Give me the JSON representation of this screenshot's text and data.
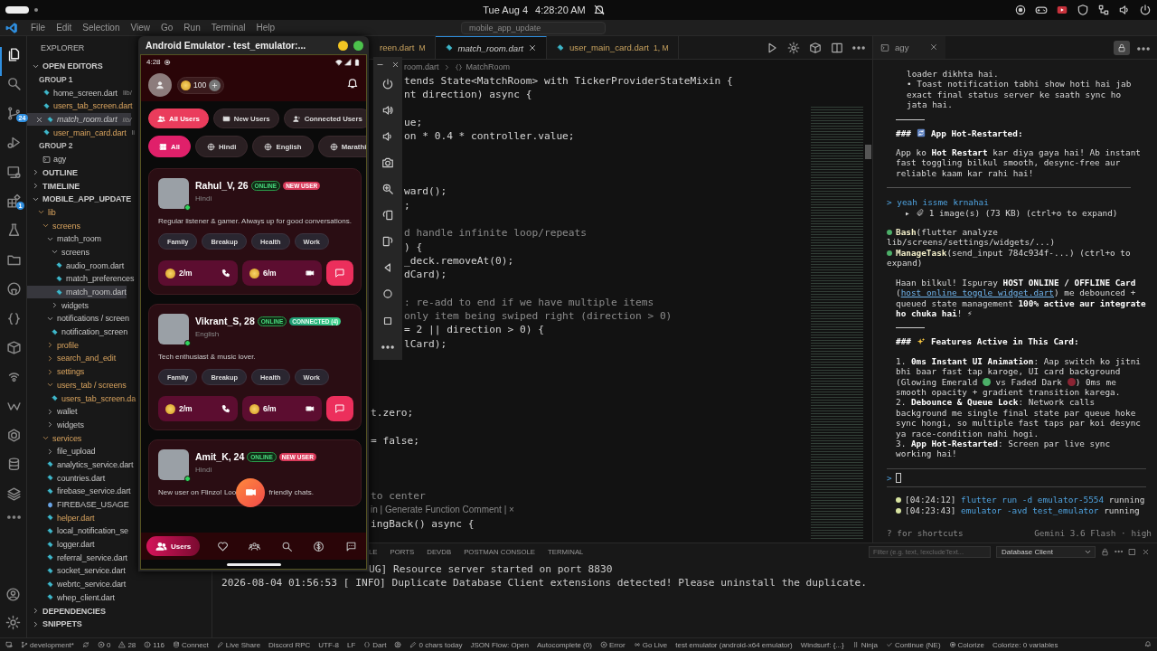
{
  "os_bar": {
    "date": "Tue Aug 4",
    "time": "4:28:20 AM"
  },
  "title_bar": {
    "menu": [
      "File",
      "Edit",
      "Selection",
      "View",
      "Go",
      "Run",
      "Terminal",
      "Help"
    ],
    "command_center": "mobile_app_update"
  },
  "activity_bar": [
    {
      "selected": true
    },
    {
      "selected": false
    },
    {
      "selected": false,
      "badge": "24"
    },
    {
      "selected": false
    },
    {
      "selected": false
    },
    {
      "selected": false,
      "badge": "1"
    },
    {
      "selected": false
    },
    {
      "selected": false
    },
    {
      "selected": false
    },
    {
      "selected": false
    },
    {
      "selected": false
    },
    {
      "selected": false
    },
    {
      "selected": false
    },
    {
      "selected": false
    },
    {
      "selected": false
    },
    {
      "selected": false
    },
    {
      "selected": false
    }
  ],
  "explorer": {
    "title": "EXPLORER",
    "sections": [
      {
        "title": "OPEN EDITORS",
        "expanded": true,
        "groups": [
          {
            "title": "GROUP 1",
            "files": [
              {
                "name": "home_screen.dart",
                "path": "lib/",
                "kind": "dart",
                "selected": false,
                "modified": false
              },
              {
                "name": "users_tab_screen.dart",
                "kind": "dart",
                "selected": false,
                "modified": true
              },
              {
                "name": "match_room.dart",
                "path": "lib/",
                "kind": "dart",
                "selected": true,
                "modified": false
              },
              {
                "name": "user_main_card.dart",
                "path": "li",
                "kind": "dart",
                "selected": false,
                "modified": true
              }
            ]
          },
          {
            "title": "GROUP 2",
            "files": [
              {
                "name": "agy",
                "kind": "terminal",
                "selected": false,
                "modified": false
              }
            ]
          }
        ]
      },
      {
        "title": "OUTLINE",
        "expanded": false
      },
      {
        "title": "TIMELINE",
        "expanded": false
      },
      {
        "title": "MOBILE_APP_UPDATE",
        "expanded": true,
        "tree": [
          {
            "name": "lib",
            "kind": "folder",
            "expanded": true,
            "modified": true,
            "children": [
              {
                "name": "screens",
                "kind": "folder",
                "expanded": true,
                "modified": true,
                "children": [
                  {
                    "name": "match_room",
                    "kind": "folder",
                    "expanded": true,
                    "modified": false,
                    "children": [
                      {
                        "name": "screens",
                        "kind": "folder",
                        "expanded": true,
                        "modified": false,
                        "children": [
                          {
                            "name": "audio_room.dart",
                            "kind": "dart",
                            "selected": false,
                            "modified": false
                          },
                          {
                            "name": "match_preferences",
                            "kind": "dart",
                            "selected": false,
                            "modified": false
                          },
                          {
                            "name": "match_room.dart",
                            "kind": "dart",
                            "selected": true,
                            "modified": false
                          }
                        ]
                      },
                      {
                        "name": "widgets",
                        "kind": "folder",
                        "expanded": false,
                        "modified": false
                      }
                    ]
                  },
                  {
                    "name": "notifications / screen",
                    "kind": "folder",
                    "expanded": true,
                    "modified": false,
                    "children": [
                      {
                        "name": "notification_screen",
                        "kind": "dart",
                        "selected": false,
                        "modified": false
                      }
                    ]
                  },
                  {
                    "name": "profile",
                    "kind": "folder",
                    "expanded": false,
                    "modified": true
                  },
                  {
                    "name": "search_and_edit",
                    "kind": "folder",
                    "expanded": false,
                    "modified": true
                  },
                  {
                    "name": "settings",
                    "kind": "folder",
                    "expanded": false,
                    "modified": true
                  },
                  {
                    "name": "users_tab / screens",
                    "kind": "folder",
                    "expanded": true,
                    "modified": true,
                    "children": [
                      {
                        "name": "users_tab_screen.da",
                        "kind": "dart",
                        "selected": false,
                        "modified": true
                      }
                    ]
                  },
                  {
                    "name": "wallet",
                    "kind": "folder",
                    "expanded": false,
                    "modified": false
                  },
                  {
                    "name": "widgets",
                    "kind": "folder",
                    "expanded": false,
                    "modified": false
                  }
                ]
              },
              {
                "name": "services",
                "kind": "folder",
                "expanded": true,
                "modified": true,
                "children": [
                  {
                    "name": "file_upload",
                    "kind": "folder",
                    "expanded": false,
                    "modified": false
                  },
                  {
                    "name": "analytics_service.dart",
                    "kind": "dart",
                    "selected": false,
                    "modified": false
                  },
                  {
                    "name": "countries.dart",
                    "kind": "dart",
                    "selected": false,
                    "modified": false
                  },
                  {
                    "name": "firebase_service.dart",
                    "kind": "dart",
                    "selected": false,
                    "modified": false
                  },
                  {
                    "name": "FIREBASE_USAGE",
                    "kind": "md",
                    "selected": false,
                    "modified": false
                  },
                  {
                    "name": "helper.dart",
                    "kind": "dart",
                    "selected": false,
                    "modified": true
                  },
                  {
                    "name": "local_notification_se",
                    "kind": "dart",
                    "selected": false,
                    "modified": false
                  },
                  {
                    "name": "logger.dart",
                    "kind": "dart",
                    "selected": false,
                    "modified": false
                  },
                  {
                    "name": "referral_service.dart",
                    "kind": "dart",
                    "selected": false,
                    "modified": false
                  },
                  {
                    "name": "socket_service.dart",
                    "kind": "dart",
                    "selected": false,
                    "modified": false
                  },
                  {
                    "name": "webrtc_service.dart",
                    "kind": "dart",
                    "selected": false,
                    "modified": false
                  },
                  {
                    "name": "whep_client.dart",
                    "kind": "dart",
                    "selected": false,
                    "modified": false
                  }
                ]
              }
            ]
          }
        ]
      },
      {
        "title": "DEPENDENCIES",
        "expanded": false
      },
      {
        "title": "SNIPPETS",
        "expanded": false
      }
    ]
  },
  "editor": {
    "tabs": [
      {
        "label": "reen.dart",
        "status": "M",
        "selected": false
      },
      {
        "label": "match_room.dart",
        "selected": true
      },
      {
        "label": "user_main_card.dart",
        "status": "1, M",
        "selected": false
      }
    ],
    "breadcrumb": [
      "room.dart",
      "MatchRoom"
    ],
    "code_blocks": [
      [
        {
          "kind": "code",
          "text": "tends State<MatchRoom> with TickerProviderStateMixin {"
        },
        {
          "kind": "code",
          "text": "nt direction) async {"
        }
      ],
      [
        {
          "kind": "code",
          "text": "ue;"
        },
        {
          "kind": "code",
          "text": "on * 0.4 * controller.value;"
        }
      ],
      [
        {
          "kind": "code",
          "text": "ward();"
        },
        {
          "kind": "code",
          "text": ";"
        }
      ],
      [
        {
          "kind": "comment",
          "text": "d handle infinite loop/repeats"
        },
        {
          "kind": "code",
          "text": ") {"
        },
        {
          "kind": "code",
          "text": "_deck.removeAt(0);"
        },
        {
          "kind": "code",
          "text": "dCard);"
        }
      ],
      [
        {
          "kind": "comment",
          "text": ": re-add to end if we have multiple items"
        },
        {
          "kind": "comment",
          "text": "only item being swiped right (direction > 0)"
        },
        {
          "kind": "code",
          "text": "= 2 || direction > 0) {"
        },
        {
          "kind": "code",
          "text": "lCard);"
        }
      ],
      [
        {
          "kind": "code",
          "text": "t.zero;"
        }
      ],
      [
        {
          "kind": "code",
          "text": "= false;"
        }
      ],
      [
        {
          "kind": "comment",
          "text": "to center"
        },
        {
          "kind": "codelens",
          "text": "in | Generate Function Comment | ×"
        },
        {
          "kind": "code",
          "text": "ingBack() async {"
        }
      ]
    ]
  },
  "bottom_panel": {
    "tabs": [
      {
        "label": "LE",
        "selected": false
      },
      {
        "label": "PORTS",
        "selected": false
      },
      {
        "label": "DEVDB",
        "selected": false
      },
      {
        "label": "POSTMAN CONSOLE",
        "selected": false
      },
      {
        "label": "TERMINAL",
        "selected": false
      }
    ],
    "filter": {
      "placeholder": "Filter (e.g. text, !excludeText..."
    },
    "dropdown": "Database Client",
    "log": [
      "UG] Resource server started on port 8830",
      "2026-08-04 01:56:53 [ INFO] Duplicate Database Client extensions detected! Please uninstall the duplicate."
    ]
  },
  "agent_panel": {
    "tab": "agy",
    "blocks": [
      {
        "kind": "sub",
        "text": "loader dikhta hai."
      },
      {
        "kind": "sub",
        "text": "• Toast notification tabhi show hoti hai jab exact final status server ke saath sync ho jata hai."
      },
      {
        "kind": "rule"
      },
      {
        "kind": "heading",
        "marker": "###",
        "text": "App Hot-Restarted:"
      },
      {
        "kind": "para",
        "parts": [
          {
            "kind": "text",
            "text": "App ko **Hot Restart** kar diya gaya hai! Ab instant fast toggling bilkul smooth, desync-free aur reliable kaam kar rahi hai!"
          }
        ]
      },
      {
        "kind": "divider"
      },
      {
        "kind": "prompt",
        "marker": ">",
        "text": "yeah issme krnahai"
      },
      {
        "kind": "attachment",
        "marker": "▸",
        "text": "1 image(s) (73 KB)  (ctrl+o to expand)"
      },
      {
        "kind": "tool",
        "name": "Bash",
        "text": "(flutter analyze lib/screens/settings/widgets/...)"
      },
      {
        "kind": "tool",
        "name": "ManageTask",
        "text": "(send_input 784c934f-...) (ctrl+o to expand)"
      },
      {
        "kind": "para",
        "parts": [
          {
            "kind": "text",
            "text": "Haan bilkul! Ispuray **HOST ONLINE / OFFLINE Card** ("
          },
          {
            "kind": "link",
            "text": "host_online_toggle_widget.dart"
          },
          {
            "kind": "text",
            "text": ") me debounced + queued state management **100% active aur integrate ho chuka hai**! ⚡"
          }
        ]
      },
      {
        "kind": "rule"
      },
      {
        "kind": "heading",
        "marker": "###",
        "text": "Features Active in This Card:"
      },
      {
        "kind": "para",
        "parts": [
          {
            "kind": "text",
            "text": "1. **0ms Instant UI Animation**: Aap switch ko jitni bhi baar fast tap karoge, UI card background (Glowing Emerald "
          },
          {
            "kind": "dot",
            "color": "#4caf68"
          },
          {
            "kind": "text",
            "text": " vs Faded Dark "
          },
          {
            "kind": "dot",
            "color": "#8a2433"
          },
          {
            "kind": "text",
            "text": ") 0ms me smooth opacity + gradient transition karega."
          }
        ]
      },
      {
        "kind": "para",
        "parts": [
          {
            "kind": "text",
            "text": "2. **Debounce & Queue Lock**: Network calls background me single final state par queue hoke sync hongi, so multiple fast taps par koi desync ya race-condition nahi hogi."
          }
        ]
      },
      {
        "kind": "para",
        "parts": [
          {
            "kind": "text",
            "text": "3. **App Hot-Restarted**: Screen par live sync working hai!"
          }
        ]
      },
      {
        "kind": "input",
        "marker": ">"
      },
      {
        "kind": "task",
        "time": "[04:24:12]",
        "command": "flutter run -d emulator-5554",
        "status": "running"
      },
      {
        "kind": "task",
        "time": "[04:23:43]",
        "command": "emulator -avd test_emulator",
        "status": "running"
      }
    ],
    "footer": {
      "hint": "? for shortcuts",
      "model": "Gemini 3.6 Flash · high"
    }
  },
  "status_bar": [
    "development*",
    "0",
    "28",
    "116",
    "Connect",
    "Live Share",
    "Discord RPC",
    "UTF-8",
    "LF",
    "Dart",
    "0 chars today",
    "JSON Flow: Open",
    "Autocomplete (0)",
    "Error",
    "Go Live",
    "test emulator (android-x64 emulator)",
    "Windsurf: {...}",
    "Ninja",
    "Continue (NE)",
    "Colorize",
    "Colorize: 0 variables"
  ],
  "emulator": {
    "title": "Android Emulator - test_emulator:...",
    "phone": {
      "time": "4:28",
      "coins": "100",
      "tabs": [
        {
          "label": "All Users",
          "selected": true
        },
        {
          "label": "New Users",
          "selected": false
        },
        {
          "label": "Connected Users",
          "selected": false
        }
      ],
      "filters": [
        {
          "label": "All",
          "selected": true
        },
        {
          "label": "Hindi",
          "selected": false
        },
        {
          "label": "English",
          "selected": false
        },
        {
          "label": "Marathi",
          "selected": false
        }
      ],
      "users": [
        {
          "name": "Rahul_V, 26",
          "online": true,
          "badges": [
            {
              "kind": "online",
              "text": "ONLINE"
            },
            {
              "kind": "new",
              "text": "NEW USER"
            }
          ],
          "language": "Hindi",
          "bio": [
            "Regular listener & gamer. Always up for good conversations."
          ],
          "tags": [
            "Family",
            "Breakup",
            "Health",
            "Work"
          ],
          "audio_price": "2/m",
          "video_price": "6/m"
        },
        {
          "name": "Vikrant_S, 28",
          "online": true,
          "badges": [
            {
              "kind": "online",
              "text": "ONLINE"
            },
            {
              "kind": "connected",
              "text": "CONNECTED (4)"
            }
          ],
          "language": "English",
          "bio": [
            "Tech enthusiast & music lover."
          ],
          "tags": [
            "Family",
            "Breakup",
            "Health",
            "Work"
          ],
          "audio_price": "2/m",
          "video_price": "6/m"
        },
        {
          "name": "Amit_K, 24",
          "online": true,
          "badges": [
            {
              "kind": "online",
              "text": "ONLINE"
            },
            {
              "kind": "new",
              "text": "NEW USER"
            }
          ],
          "language": "Hindi",
          "bio": [
            "New user on Flinzo! Loo",
            "friendly chats."
          ]
        }
      ],
      "nav": [
        {
          "label": "Users",
          "selected": true
        },
        {
          "selected": false
        },
        {
          "selected": false
        },
        {
          "selected": false
        },
        {
          "selected": false
        },
        {
          "selected": false
        }
      ]
    }
  }
}
